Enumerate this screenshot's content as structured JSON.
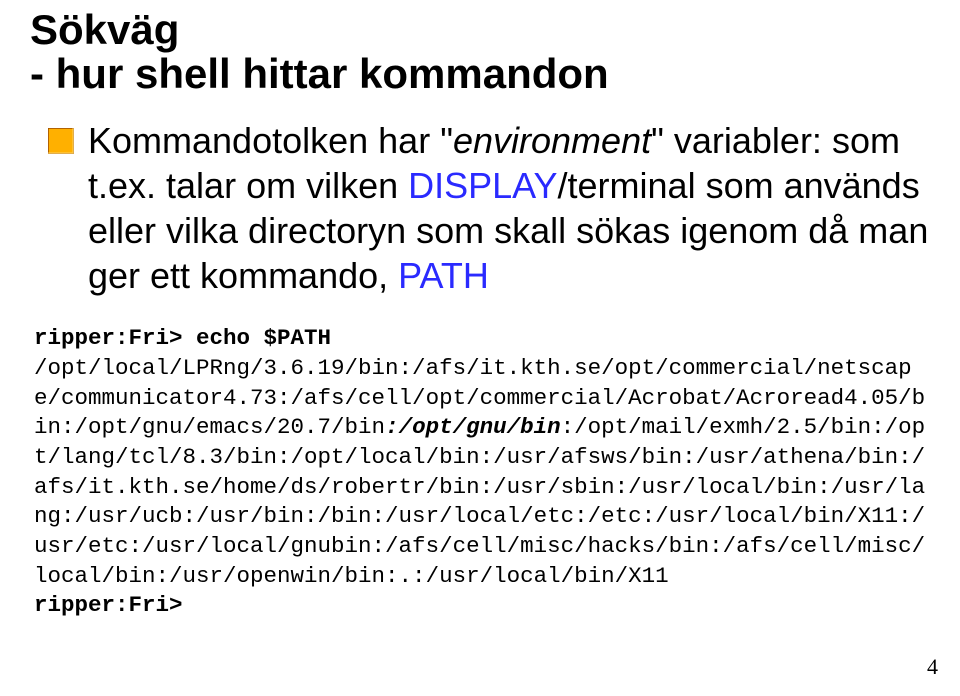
{
  "title_line1": "Sökväg",
  "title_line2": "- hur shell hittar kommandon",
  "bullet": {
    "pre": "Kommandotolken har \"",
    "env": "environment",
    "post_quote_line1": "\" variabler: som t.ex. talar om vilken ",
    "display_kw": "DISPLAY",
    "mid": "/terminal som används eller vilka directoryn som skall sökas igenom då man ger ett kommando, ",
    "path_kw": "PATH"
  },
  "terminal": {
    "prompt1": "ripper:Fri> ",
    "cmd": "echo $PATH",
    "seg1": "/opt/local/LPRng/3.6.19/bin:/afs/it.kth.se/opt/commercial/netscape/communicator4.73:/afs/cell/opt/commercial/Acrobat/Acroread4.05/bin:/opt/gnu/emacs/20.7/bin",
    "seg_optgnubin": ":/opt/gnu/bin",
    "seg2": ":/opt/mail/exmh/2.5/bin:/opt/lang/tcl/8.3/bin:/opt/local/bin:/usr/afsws/bin:/usr/athena/bin:/afs/it.kth.se/home/ds/robertr/bin:/usr/sbin:/usr/local/bin:/usr/lang:/usr/ucb:/usr/bin:/bin:/usr/local/etc:/etc:/usr/local/bin/X11:/usr/etc:/usr/local/gnubin:/afs/cell/misc/hacks/bin:/afs/cell/misc/local/bin:/usr/openwin/bin:.:/usr/local/bin/X11",
    "prompt2": "ripper:Fri>"
  },
  "page_number": "4"
}
